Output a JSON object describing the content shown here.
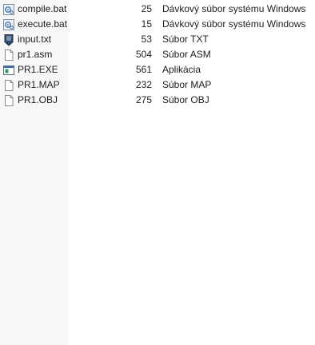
{
  "files": [
    {
      "name": "compile.bat",
      "size": "25",
      "type": "Dávkový súbor systému Windows",
      "icon": "batch-file-icon"
    },
    {
      "name": "execute.bat",
      "size": "15",
      "type": "Dávkový súbor systému Windows",
      "icon": "batch-file-icon"
    },
    {
      "name": "input.txt",
      "size": "53",
      "type": "Súbor TXT",
      "icon": "text-file-icon"
    },
    {
      "name": "pr1.asm",
      "size": "504",
      "type": "Súbor ASM",
      "icon": "blank-file-icon"
    },
    {
      "name": "PR1.EXE",
      "size": "561",
      "type": "Aplikácia",
      "icon": "executable-icon"
    },
    {
      "name": "PR1.MAP",
      "size": "232",
      "type": "Súbor MAP",
      "icon": "blank-file-icon"
    },
    {
      "name": "PR1.OBJ",
      "size": "275",
      "type": "Súbor OBJ",
      "icon": "blank-file-icon"
    }
  ]
}
